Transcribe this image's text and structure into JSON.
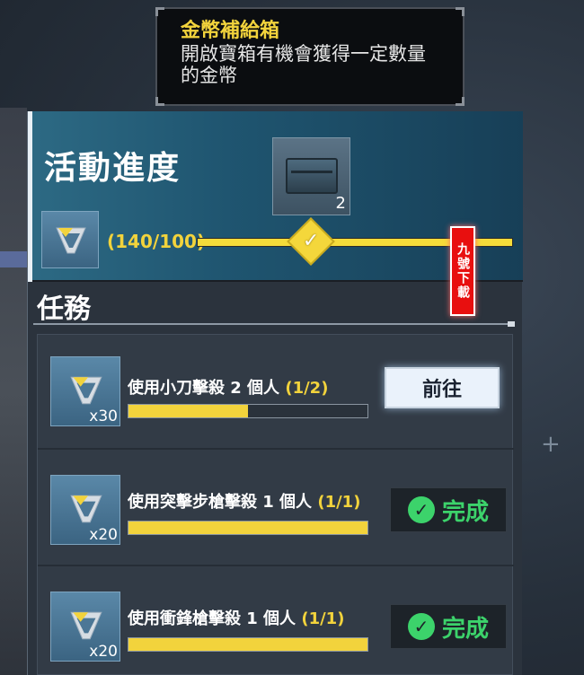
{
  "tooltip": {
    "title": "金幣補給箱",
    "description": "開啟寶箱有機會獲得一定數量的金幣"
  },
  "header": {
    "title": "活動進度",
    "reward_count": "2",
    "progress_text": "(140/100)",
    "progress_fraction": 1.0,
    "milestone_icon": "checkmark-icon"
  },
  "watermark": "九號下載",
  "tasks_title": "任務",
  "tasks": [
    {
      "description": "使用小刀擊殺 2 個人",
      "progress": "(1/2)",
      "fraction": 0.5,
      "reward_count": "x30",
      "action_type": "go",
      "action_label": "前往"
    },
    {
      "description": "使用突擊步槍擊殺 1 個人",
      "progress": "(1/1)",
      "fraction": 1.0,
      "reward_count": "x20",
      "action_type": "done",
      "action_label": "完成"
    },
    {
      "description": "使用衝鋒槍擊殺 1 個人",
      "progress": "(1/1)",
      "fraction": 1.0,
      "reward_count": "x20",
      "action_type": "done",
      "action_label": "完成"
    }
  ],
  "colors": {
    "accent_yellow": "#f2d33c",
    "complete_green": "#3cd36b",
    "header_teal": "#2d6a84"
  }
}
